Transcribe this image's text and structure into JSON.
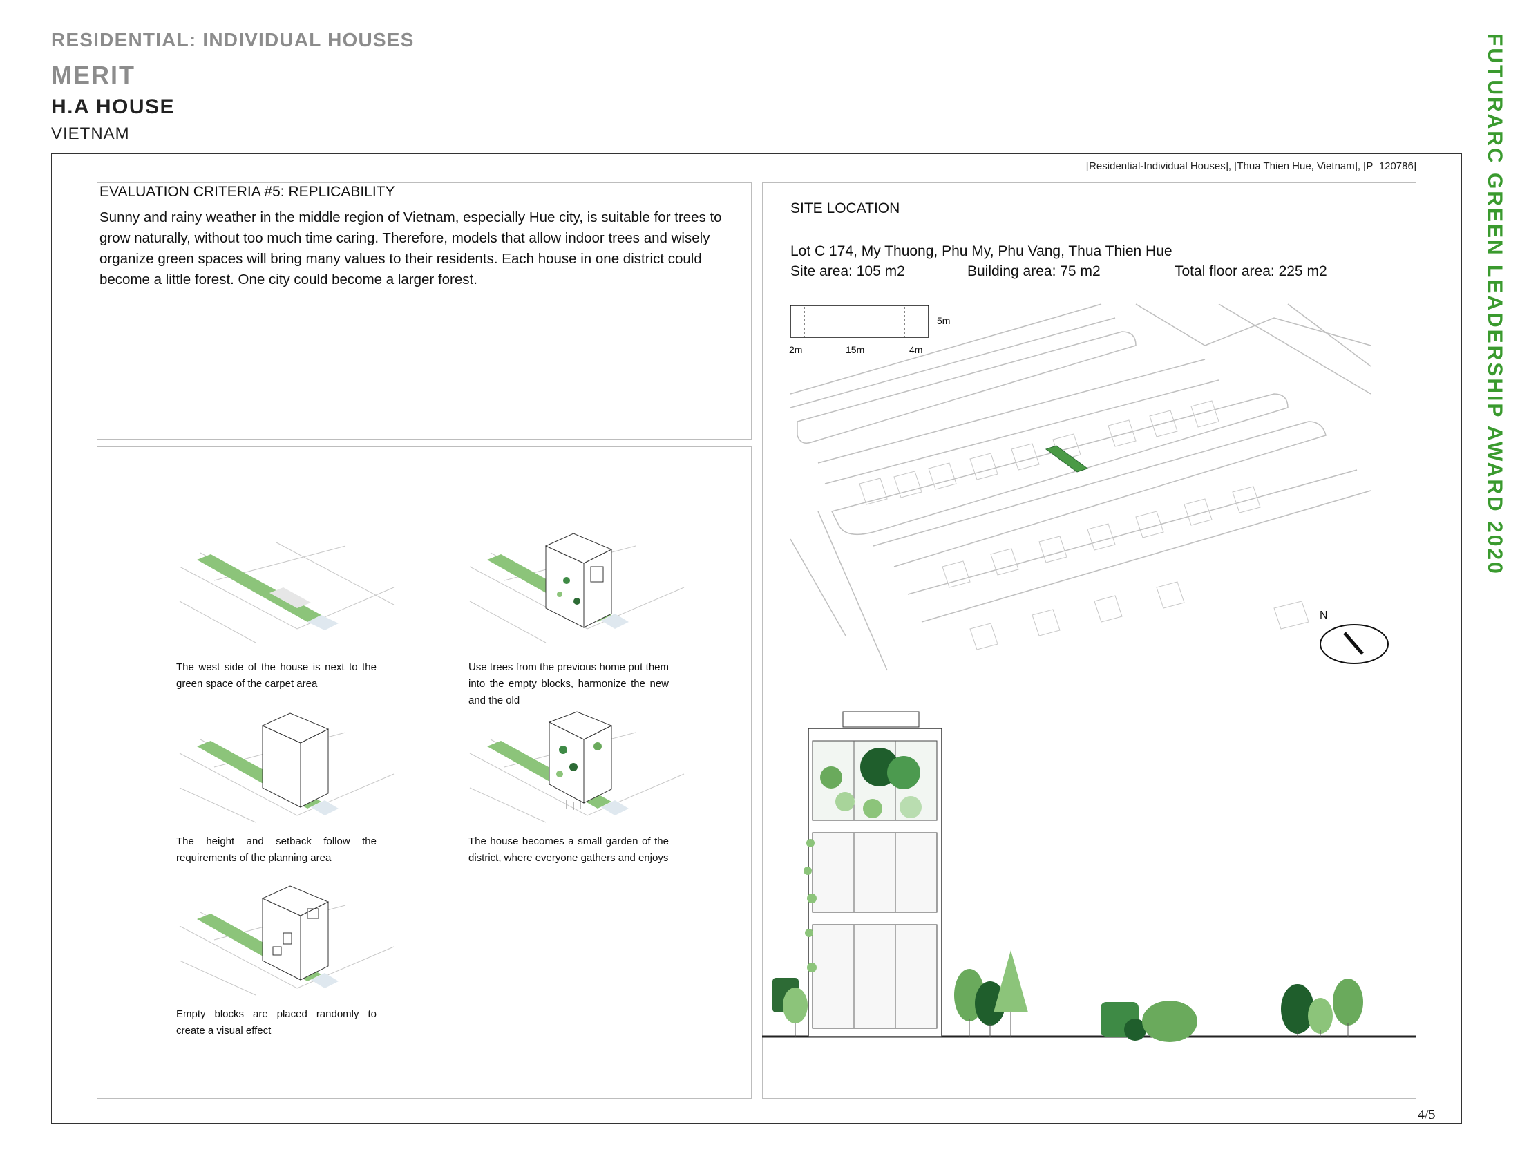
{
  "header": {
    "category": "RESIDENTIAL: INDIVIDUAL HOUSES",
    "rank": "MERIT",
    "project": "H.A HOUSE",
    "country": "VIETNAM"
  },
  "award_title": "FUTURARC GREEN LEADERSHIP AWARD 2020",
  "reference": "[Residential-Individual Houses], [Thua Thien Hue, Vietnam], [P_120786]",
  "criteria": {
    "title": "EVALUATION CRITERIA #5: REPLICABILITY",
    "body": "Sunny and rainy weather in the middle region of Vietnam, especially Hue city, is suitable for trees to grow naturally, without too much time caring. Therefore, models that allow indoor trees and wisely organize green spaces will bring many values to their residents. Each house in one district could become a little forest. One city could become a larger forest."
  },
  "diagrams": [
    {
      "caption": "The west side of the house is next to the green space of the carpet area"
    },
    {
      "caption": "Use trees from the previous home put them into the empty blocks, harmonize the new and the old"
    },
    {
      "caption": "The height and setback follow the requirements of the planning area"
    },
    {
      "caption": "The house becomes a small garden of the district, where everyone gathers and enjoys"
    },
    {
      "caption": "Empty blocks are placed randomly to create a visual effect"
    }
  ],
  "site": {
    "title": "SITE LOCATION",
    "address": "Lot C 174, My Thuong, Phu My, Phu Vang, Thua Thien Hue",
    "site_area": "Site area: 105 m2",
    "building_area": "Building area: 75 m2",
    "total_floor_area": "Total floor area: 225 m2",
    "scale_labels": {
      "w": "5m",
      "a": "2m",
      "b": "15m",
      "c": "4m"
    },
    "north": "N"
  },
  "page": "4/5",
  "colors": {
    "green": "#3a9a2e",
    "leaf": "#8cc47a",
    "dark_leaf": "#1f5e2c"
  }
}
